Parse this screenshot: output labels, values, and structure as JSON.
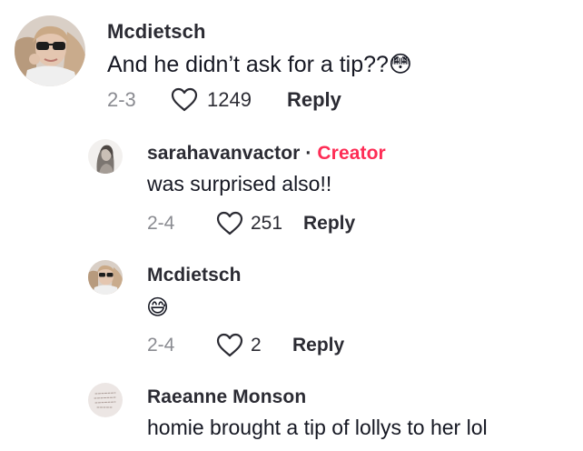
{
  "comments": [
    {
      "username": "Mcdietsch",
      "text": "And he didn’t ask for a tip??😳",
      "date": "2-3",
      "likes": "1249",
      "reply_label": "Reply"
    },
    {
      "username": "sarahavanvactor",
      "separator": "·",
      "creator_label": "Creator",
      "text": "was surprised also!!",
      "date": "2-4",
      "likes": "251",
      "reply_label": "Reply"
    },
    {
      "username": "Mcdietsch",
      "text": "😅",
      "date": "2-4",
      "likes": "2",
      "reply_label": "Reply"
    },
    {
      "username": "Raeanne Monson",
      "text": "homie brought a tip of lollys to her lol"
    }
  ],
  "icons": {
    "like": "heart-outline-icon"
  },
  "colors": {
    "creator": "#fe2c55",
    "date": "#8a8b91",
    "text": "#161823"
  }
}
